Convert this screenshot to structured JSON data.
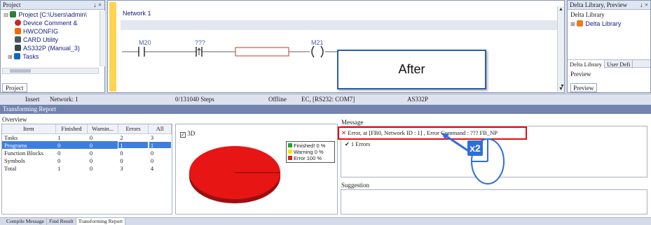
{
  "project_panel": {
    "title": "Project",
    "pin": "↓ ×",
    "tree": [
      {
        "label": "Project [C:\\Users\\admin\\",
        "icon": "project-icon",
        "color": "#2e7d32"
      },
      {
        "label": "Device Comment &",
        "icon": "device-comment-icon",
        "color": "#c62828"
      },
      {
        "label": "HWCONFIG",
        "icon": "hwconfig-icon",
        "color": "#ef6c00"
      },
      {
        "label": "CARD Utility",
        "icon": "card-utility-icon",
        "color": "#455a64"
      },
      {
        "label": "AS332P (Manual_3)",
        "icon": "cpu-icon",
        "color": "#37474f"
      },
      {
        "label": "Tasks",
        "icon": "tasks-icon",
        "color": "#1565c0"
      }
    ],
    "bottom_tab": "Project"
  },
  "editor": {
    "network_label": "Network 1",
    "contacts": [
      {
        "label": "M20",
        "type": "NO contact"
      },
      {
        "label": "???",
        "type": "positive transition contact"
      }
    ],
    "coil_label": "M21",
    "callout": "After"
  },
  "library_panel": {
    "title": "Delta Library, Preview",
    "pin": "↓ ×",
    "subtitle": "Delta Library",
    "tree_item": "Delta Library",
    "tabs": [
      "Delta Library",
      "User Defi"
    ],
    "preview_header": "Preview",
    "preview_tab": "Preview"
  },
  "status_bar": {
    "mode": "Insert",
    "network": "Network: 1",
    "steps": "0/131040 Steps",
    "online": "Offline",
    "comm": "EC, [RS232: COM7]",
    "plc": "AS332P"
  },
  "report": {
    "title": "Transforming Report",
    "overview_label": "Overview",
    "columns": [
      "Item",
      "Finished",
      "Warnin...",
      "Errors",
      "All"
    ],
    "rows": [
      {
        "item": "Tasks",
        "finished": "1",
        "warnings": "0",
        "errors": "2",
        "all": "3"
      },
      {
        "item": "Programs",
        "finished": "0",
        "warnings": "0",
        "errors": "1",
        "all": "1"
      },
      {
        "item": "Function Blocks",
        "finished": "0",
        "warnings": "0",
        "errors": "0",
        "all": "0"
      },
      {
        "item": "Symbols",
        "finished": "0",
        "warnings": "0",
        "errors": "0",
        "all": "0"
      },
      {
        "item": "Total",
        "finished": "1",
        "warnings": "0",
        "errors": "3",
        "all": "4"
      }
    ],
    "checkbox_3d_label": "3D",
    "legend": [
      {
        "label": "Finished! 0 %",
        "color": "#21a336"
      },
      {
        "label": "Warning 0 %",
        "color": "#f3e900"
      },
      {
        "label": "Error 100 %",
        "color": "#e02020"
      }
    ],
    "message_label": "Message",
    "error_message": "Error, at [FB0, Network ID : 1] , Error Command : ??? FB_NP",
    "errors_count": "1 Errors",
    "suggestion_label": "Suggestion",
    "click_badge": "x2",
    "bottom_tabs": [
      "Compile Message",
      "Find Result",
      "Transforming Report"
    ]
  },
  "colors": {
    "selection": "#3d7ee0",
    "report_title_bar": "#7283ad",
    "callout_border": "#2a5db0",
    "highlight_red": "#e01010",
    "rung_yellow": "#ffd54f"
  }
}
